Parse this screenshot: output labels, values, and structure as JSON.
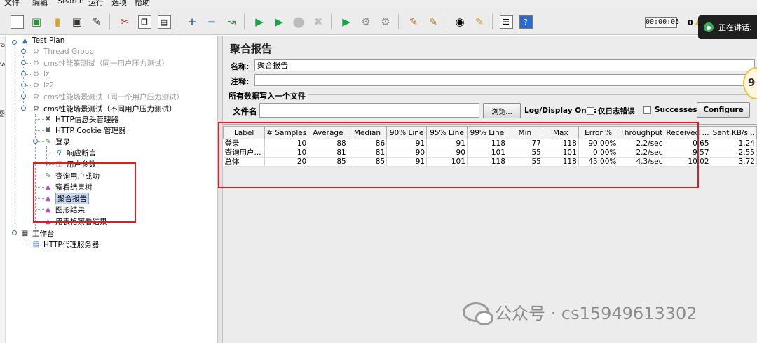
{
  "menu": [
    "文件",
    "编辑",
    "Search",
    "运行",
    "选项",
    "帮助"
  ],
  "toolbar": {
    "timer": "00:00:05",
    "active_count": "0",
    "notification": "正在讲话:"
  },
  "edge_labels": [
    "ra",
    "ive",
    "图"
  ],
  "tree": {
    "test_plan": "Test Plan",
    "thread_group": "Thread Group",
    "cms_strategy": "cms性能策测试（同一用户压力测试）",
    "lz": "lz",
    "lz2": "lz2",
    "cms_scene_same": "cms性能场景测试（同一个用户压力测试）",
    "cms_scene_diff": "cms性能场景测试（不同用户压力测试）",
    "http_header": "HTTP信息头管理器",
    "http_cookie": "HTTP Cookie 管理器",
    "login": "登录",
    "response_assert": "响应断言",
    "user_params": "用户参数",
    "query_success": "查询用户成功",
    "view_tree": "察看结果树",
    "aggregate": "聚合报告",
    "graph": "图形结果",
    "table_view": "用表格察看结果",
    "workbench": "工作台",
    "proxy": "HTTP代理服务器"
  },
  "report": {
    "title": "聚合报告",
    "name_label": "名称:",
    "name_value": "聚合报告",
    "comment_label": "注释:",
    "comment_value": "",
    "write_section": "所有数据写入一个文件",
    "filename_label": "文件名",
    "filename_value": "",
    "browse_button": "浏览...",
    "log_display": "Log/Display Only:",
    "errors_only": "仅日志错误",
    "successes": "Successes",
    "configure_button": "Configure",
    "badge": "9"
  },
  "table": {
    "columns": [
      "Label",
      "# Samples",
      "Average",
      "Median",
      "90% Line",
      "95% Line",
      "99% Line",
      "Min",
      "Max",
      "Error %",
      "Throughput",
      "Received ...",
      "Sent KB/s..."
    ],
    "rows": [
      [
        "登录",
        "10",
        "88",
        "86",
        "91",
        "91",
        "118",
        "77",
        "118",
        "90.00%",
        "2.2/sec",
        "0.65",
        "1.24"
      ],
      [
        "查询用户...",
        "10",
        "81",
        "81",
        "90",
        "90",
        "101",
        "55",
        "101",
        "0.00%",
        "2.2/sec",
        "9.57",
        "2.55"
      ],
      [
        "总体",
        "20",
        "85",
        "85",
        "91",
        "101",
        "118",
        "55",
        "118",
        "45.00%",
        "4.3/sec",
        "10.02",
        "3.72"
      ]
    ]
  },
  "watermark": "公众号 · cs15949613302",
  "colors": {
    "highlight_box": "#e01b24",
    "selection": "#c6d6ee",
    "play_green": "#1aa34a"
  }
}
